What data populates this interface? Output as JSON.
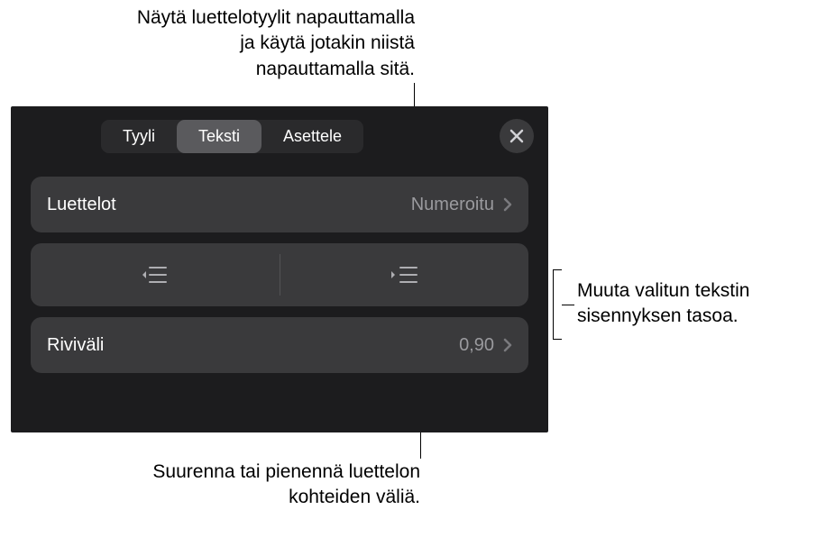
{
  "callouts": {
    "top": "Näytä luettelotyylit napauttamalla\nja käytä jotakin niistä\nnapauttamalla sitä.",
    "right": "Muuta valitun tekstin\nsisennyksen tasoa.",
    "bottom": "Suurenna tai pienennä luettelon\nkohteiden väliä."
  },
  "tabs": {
    "style": "Tyyli",
    "text": "Teksti",
    "layout": "Asettele"
  },
  "rows": {
    "lists": {
      "label": "Luettelot",
      "value": "Numeroitu"
    },
    "linespacing": {
      "label": "Riviväli",
      "value": "0,90"
    }
  }
}
